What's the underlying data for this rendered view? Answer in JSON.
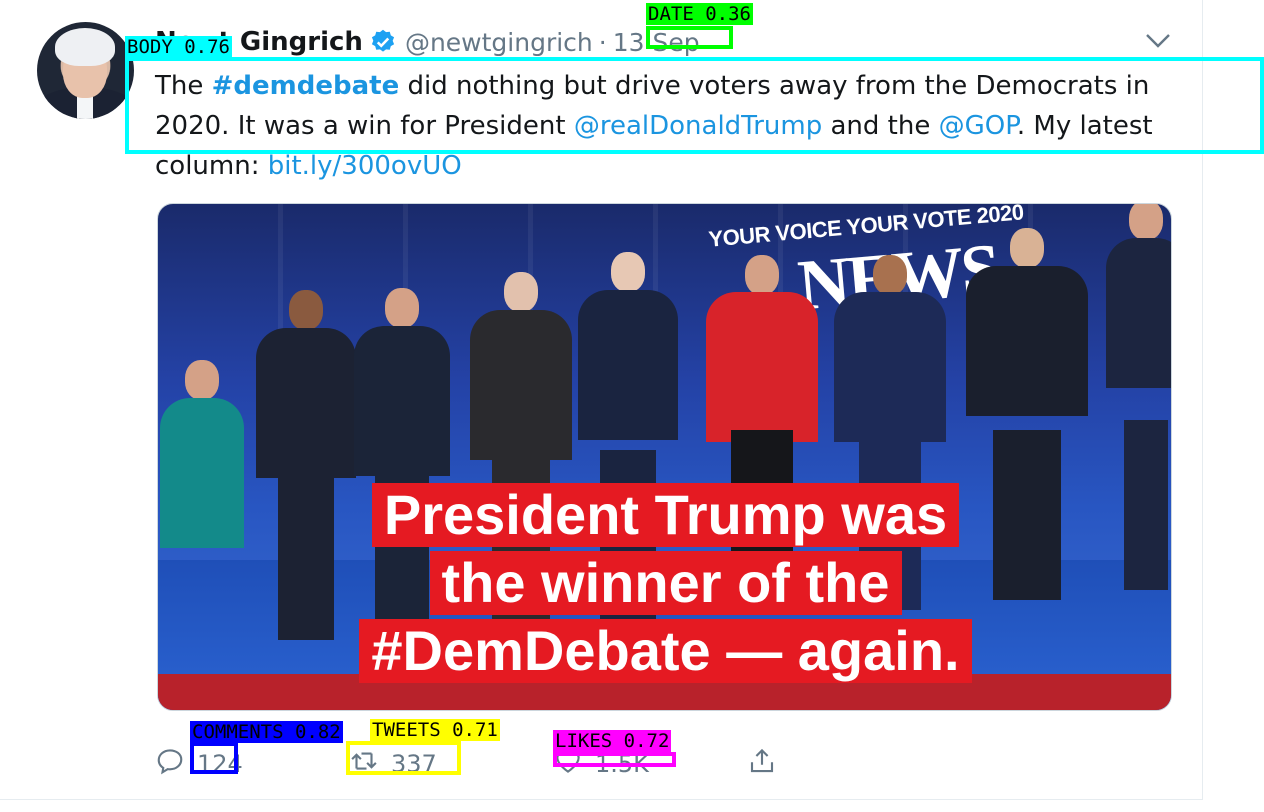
{
  "tweet": {
    "author_name": "Newt Gingrich",
    "handle": "@newtgingrich",
    "separator": "·",
    "date": "13 Sep",
    "body": {
      "t1": "The ",
      "hashtag": "#demdebate",
      "t2": " did nothing but drive voters away from the Democrats in 2020. It was a win for President ",
      "mention1": "@realDonaldTrump",
      "t3": " and the ",
      "mention2": "@GOP",
      "t4": ". My latest column: ",
      "link": "bit.ly/300ovUO"
    },
    "media": {
      "banner": "YOUR VOICE YOUR VOTE 2020",
      "logo": "NEWS",
      "caption_lines": [
        "President Trump was",
        "the winner of the",
        "#DemDebate — again."
      ]
    },
    "actions": {
      "reply_count": "124",
      "retweet_count": "337",
      "like_count": "1.5K"
    }
  },
  "detections": {
    "body": "BODY 0.76",
    "date": "DATE 0.36",
    "comments": "COMMENTS 0.82",
    "tweets": "TWEETS 0.71",
    "likes": "LIKES 0.72"
  },
  "colors": {
    "link": "#1b95e0",
    "text": "#14171a",
    "muted": "#657786",
    "det_body": "#00ffff",
    "det_date": "#00ff00",
    "det_comments": "#0000ff",
    "det_tweets": "#ffff00",
    "det_likes": "#ff00ff"
  },
  "icons": [
    "verified-badge-icon",
    "chevron-down-icon",
    "reply-icon",
    "retweet-icon",
    "like-icon",
    "share-icon"
  ]
}
